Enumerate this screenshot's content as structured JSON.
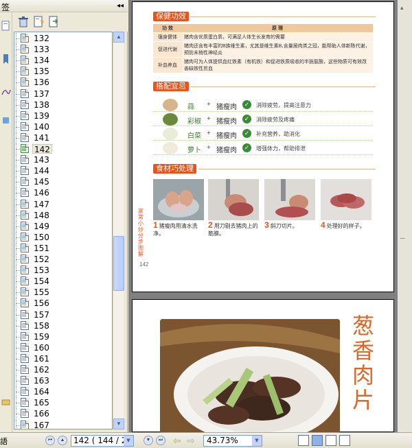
{
  "bookmarks_panel": {
    "title": "签",
    "collapse_glyph": "◂◂",
    "toolbar": {
      "delete_icon": "trash-icon",
      "new_bookmark_icon": "new-bookmark-icon",
      "go_icon": "go-to-bookmark-icon"
    },
    "items": [
      "132",
      "133",
      "134",
      "135",
      "136",
      "137",
      "138",
      "139",
      "140",
      "141",
      "142",
      "143",
      "144",
      "145",
      "146",
      "147",
      "148",
      "149",
      "150",
      "151",
      "152",
      "153",
      "154",
      "155",
      "156",
      "157",
      "158",
      "159",
      "160",
      "161",
      "162",
      "163",
      "164",
      "165",
      "166",
      "167"
    ],
    "selected": "142"
  },
  "page_top": {
    "section1": "保健功效",
    "table": {
      "headers": [
        "功 效",
        "原 理"
      ],
      "rows": [
        [
          "强身健体",
          "猪肉含优质蛋白质，可满足人体生长发育的需要"
        ],
        [
          "促进代谢",
          "猪肉还含有丰富的B族维生素，尤其是维生素B₁含量居肉类之冠，能帮助人体新陈代谢，预防末梢性神经炎"
        ],
        [
          "补血养血",
          "猪肉可为人体提供血红铁素（有机铁）和促进铁质吸收的半胱氨酸，这些物质可有效改善缺铁性贫血"
        ]
      ]
    },
    "section2": "搭配宜忌",
    "pairings": [
      {
        "ingredient": "蒜",
        "plus": "+",
        "with": "猪瘦肉",
        "effect": "消除疲劳，提高注意力"
      },
      {
        "ingredient": "彩椒",
        "plus": "+",
        "with": "猪瘦肉",
        "effect": "消除疲劳及疼痛"
      },
      {
        "ingredient": "白菜",
        "plus": "+",
        "with": "猪瘦肉",
        "effect": "补充营养，助消化"
      },
      {
        "ingredient": "萝卜",
        "plus": "+",
        "with": "猪瘦肉",
        "effect": "增强体力，帮助排泄"
      }
    ],
    "section3": "食材巧处理",
    "steps": [
      {
        "num": "1",
        "text": "猪瘦肉用清水洗净。"
      },
      {
        "num": "2",
        "text": "用刀剔去猪肉上的筋膜。"
      },
      {
        "num": "3",
        "text": "斜刀切片。"
      },
      {
        "num": "4",
        "text": "处理好的样子。"
      }
    ],
    "side_text": "家常小炒分步图解",
    "page_number": "142"
  },
  "page_bottom": {
    "title": "葱香肉片"
  },
  "statusbar": {
    "page_field": "142  ( 144 / 25",
    "zoom": "43.73%",
    "left_label": "語"
  },
  "colors": {
    "accent": "#e8541c",
    "xp_bg": "#ece9d8",
    "scroll_blue": "#c1d3fb"
  }
}
